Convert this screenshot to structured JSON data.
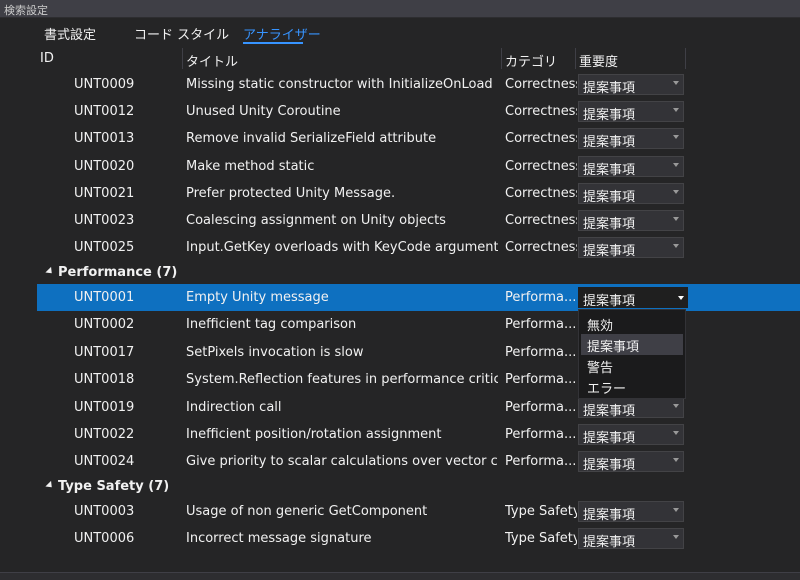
{
  "search": {
    "placeholder": "検索設定"
  },
  "tabs": [
    {
      "label": "書式設定"
    },
    {
      "label": "コード スタイル"
    },
    {
      "label": "アナライザー"
    }
  ],
  "columns": {
    "id": "ID",
    "title": "タイトル",
    "category": "カテゴリ",
    "severity": "重要度"
  },
  "rows_top": [
    {
      "id": "UNT0009",
      "title": "Missing static constructor with InitializeOnLoad",
      "category": "Correctness",
      "severity": "提案事項"
    },
    {
      "id": "UNT0012",
      "title": "Unused Unity Coroutine",
      "category": "Correctness",
      "severity": "提案事項"
    },
    {
      "id": "UNT0013",
      "title": "Remove invalid SerializeField attribute",
      "category": "Correctness",
      "severity": "提案事項"
    },
    {
      "id": "UNT0020",
      "title": "Make method static",
      "category": "Correctness",
      "severity": "提案事項"
    },
    {
      "id": "UNT0021",
      "title": "Prefer protected Unity Message.",
      "category": "Correctness",
      "severity": "提案事項"
    },
    {
      "id": "UNT0023",
      "title": "Coalescing assignment on Unity objects",
      "category": "Correctness",
      "severity": "提案事項"
    },
    {
      "id": "UNT0025",
      "title": "Input.GetKey overloads with KeyCode argument",
      "category": "Correctness",
      "severity": "提案事項"
    }
  ],
  "group_performance": {
    "label": "Performance (7)"
  },
  "rows_perf": [
    {
      "id": "UNT0001",
      "title": "Empty Unity message",
      "category": "Performa...",
      "severity": "提案事項"
    },
    {
      "id": "UNT0002",
      "title": "Inefficient tag comparison",
      "category": "Performa...",
      "severity": ""
    },
    {
      "id": "UNT0017",
      "title": "SetPixels invocation is slow",
      "category": "Performa...",
      "severity": ""
    },
    {
      "id": "UNT0018",
      "title": "System.Reflection features in performance critical...",
      "category": "Performa...",
      "severity": ""
    },
    {
      "id": "UNT0019",
      "title": "Indirection call",
      "category": "Performa...",
      "severity": "提案事項"
    },
    {
      "id": "UNT0022",
      "title": "Inefficient position/rotation assignment",
      "category": "Performa...",
      "severity": "提案事項"
    },
    {
      "id": "UNT0024",
      "title": "Give priority to scalar calculations over vector calc...",
      "category": "Performa...",
      "severity": "提案事項"
    }
  ],
  "group_typesafety": {
    "label": "Type Safety (7)"
  },
  "rows_ts": [
    {
      "id": "UNT0003",
      "title": "Usage of non generic GetComponent",
      "category": "Type Safety",
      "severity": "提案事項"
    },
    {
      "id": "UNT0006",
      "title": "Incorrect message signature",
      "category": "Type Safety",
      "severity": "提案事項"
    }
  ],
  "severity_options": [
    "無効",
    "提案事項",
    "警告",
    "エラー"
  ],
  "colors": {
    "background": "#252526",
    "selection": "#0e70c0",
    "accent": "#3794ff"
  }
}
